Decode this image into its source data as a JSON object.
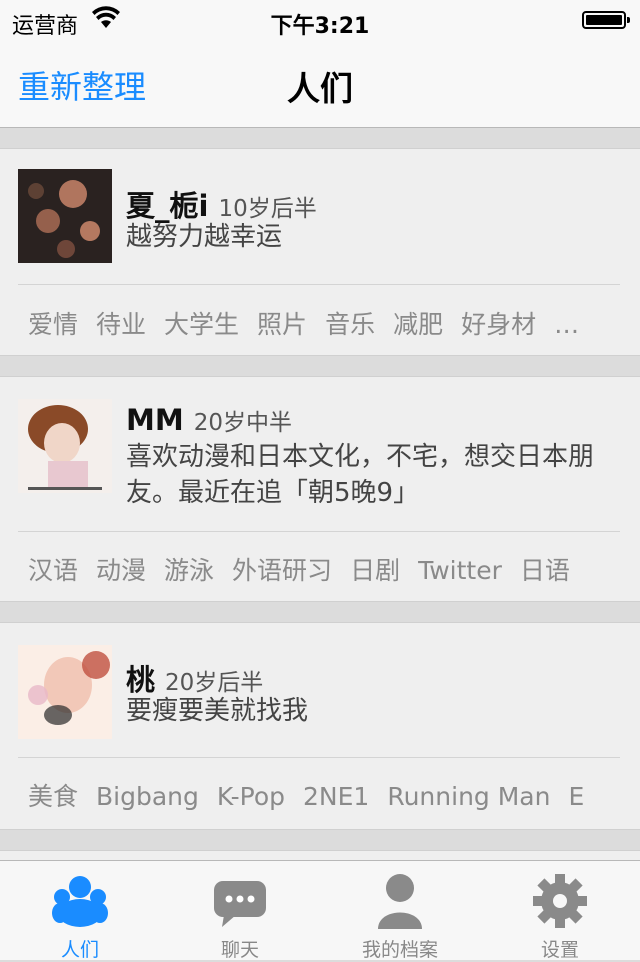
{
  "status_bar": {
    "carrier": "运营商",
    "time": "下午3:21",
    "wifi_icon": "wifi-icon",
    "battery_icon": "battery-icon"
  },
  "nav": {
    "left_button": "重新整理",
    "title": "人们"
  },
  "people": [
    {
      "name": "夏_栀i",
      "age": "10岁后半",
      "bio": "越努力越幸运",
      "tags": [
        "爱情",
        "待业",
        "大学生",
        "照片",
        "音乐",
        "减肥",
        "好身材",
        "…"
      ]
    },
    {
      "name": "MM",
      "age": "20岁中半",
      "bio": "喜欢动漫和日本文化，不宅，想交日本朋友。最近在追「朝5晚9」",
      "tags": [
        "汉语",
        "动漫",
        "游泳",
        "外语研习",
        "日剧",
        "Twitter",
        "日语"
      ]
    },
    {
      "name": "桃",
      "age": "20岁后半",
      "bio": "要瘦要美就找我",
      "tags": [
        "美食",
        "Bigbang",
        "K-Pop",
        "2NE1",
        "Running Man",
        "E"
      ]
    }
  ],
  "tabs": [
    {
      "label": "人们",
      "icon": "people-icon",
      "active": true
    },
    {
      "label": "聊天",
      "icon": "chat-bubble-icon",
      "active": false
    },
    {
      "label": "我的档案",
      "icon": "profile-icon",
      "active": false
    },
    {
      "label": "设置",
      "icon": "gear-icon",
      "active": false
    }
  ],
  "colors": {
    "accent": "#1a8cff",
    "inactive_tab": "#888888",
    "card_bg": "#efefef",
    "separator_bg": "#dcdcdc"
  }
}
